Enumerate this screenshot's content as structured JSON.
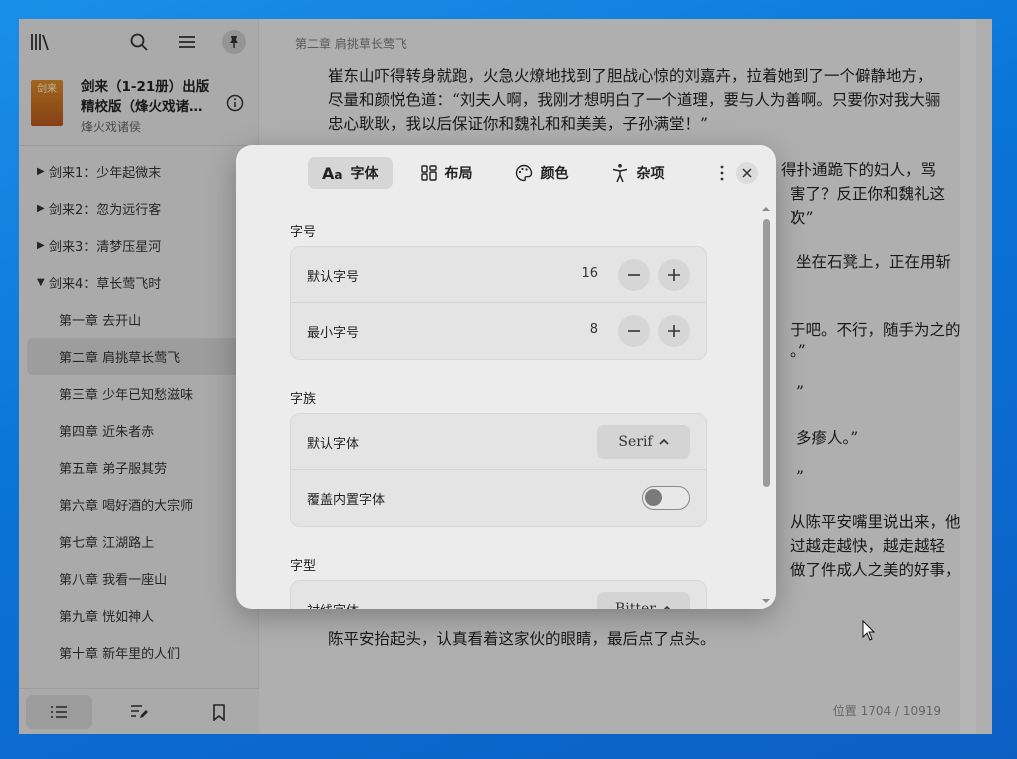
{
  "sidebar": {
    "book": {
      "cover_text": "剑来",
      "title": "剑来（1-21册）出版\n精校版（烽火戏诸…",
      "author": "烽火戏诸侯"
    },
    "toc": [
      {
        "label": "剑来1：少年起微末",
        "arrow": "▶"
      },
      {
        "label": "剑来2：忽为远行客",
        "arrow": "▶"
      },
      {
        "label": "剑来3：清梦压星河",
        "arrow": "▶"
      },
      {
        "label": "剑来4：草长莺飞时",
        "arrow": "▼"
      },
      {
        "label": "第一章 去开山"
      },
      {
        "label": "第二章 肩挑草长莺飞"
      },
      {
        "label": "第三章 少年已知愁滋味"
      },
      {
        "label": "第四章 近朱者赤"
      },
      {
        "label": "第五章 弟子服其劳"
      },
      {
        "label": "第六章 喝好酒的大宗师"
      },
      {
        "label": "第七章 江湖路上"
      },
      {
        "label": "第八章 我看一座山"
      },
      {
        "label": "第九章 恍如神人"
      },
      {
        "label": "第十章 新年里的人们"
      }
    ]
  },
  "reader": {
    "chapter_header": "第二章 肩挑草长莺飞",
    "paragraphs": [
      "崔东山吓得转身就跑，火急火燎地找到了胆战心惊的刘嘉卉，拉着她到了一个僻静地方，尽量和颜悦色道：“刘夫人啊，我刚才想明白了一个道理，要与人为善啊。只要你对我大骊忠心耿耿，我以后保证你和魏礼和和美美，子孙满堂！”",
      "得扑通跪下的妇人，骂",
      "害了？反正你和魏礼这次",
      "！”",
      "坐在石凳上，正在用斩",
      "于吧。不行，随手为之的",
      "。”",
      "”",
      "多瘆人。”",
      "”",
      "从陈平安嘴里说出来，他",
      "过越走越快，越走越轻",
      "做了件成人之美的好事，",
      "陈平安抬起头，认真看着这家伙的眼睛，最后点了点头。"
    ],
    "position": "位置 1704 / 10919"
  },
  "dialog": {
    "tabs": [
      {
        "label": "字体",
        "icon": "font-icon"
      },
      {
        "label": "布局",
        "icon": "layout-icon"
      },
      {
        "label": "颜色",
        "icon": "palette-icon"
      },
      {
        "label": "杂项",
        "icon": "accessibility-icon"
      }
    ],
    "sections": {
      "size": {
        "label": "字号",
        "default_label": "默认字号",
        "default_value": "16",
        "min_label": "最小字号",
        "min_value": "8"
      },
      "family": {
        "label": "字族",
        "default_label": "默认字体",
        "default_value": "Serif",
        "override_label": "覆盖内置字体",
        "override_on": false
      },
      "face": {
        "label": "字型",
        "serif_label": "衬线字体",
        "serif_value": "Bitter"
      }
    }
  }
}
